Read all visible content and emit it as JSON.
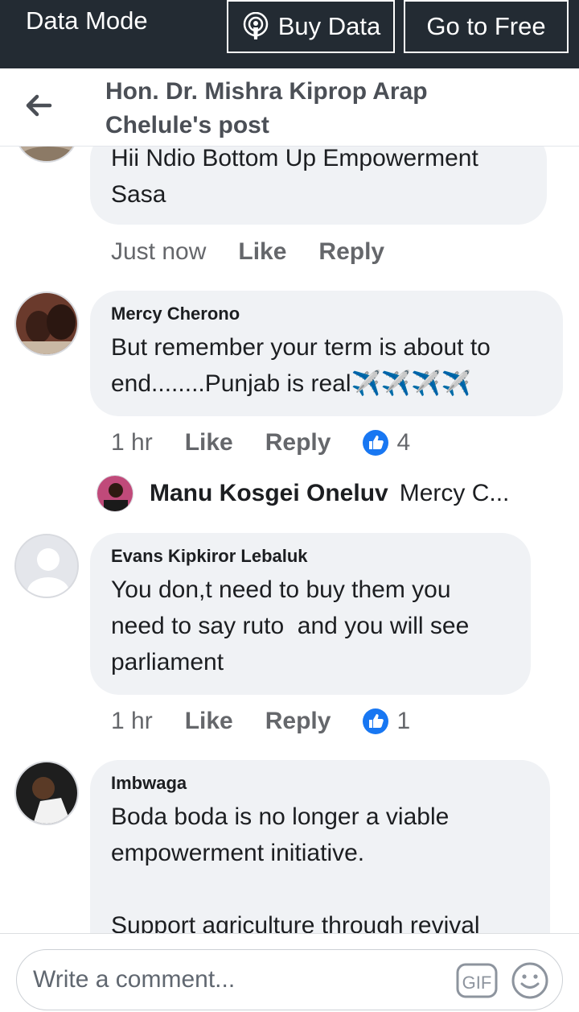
{
  "databar": {
    "mode_label": "Data Mode",
    "buy_label": "Buy Data",
    "free_label": "Go to Free"
  },
  "header": {
    "title": "Hon. Dr. Mishra Kiprop Arap Chelule's post"
  },
  "comments": [
    {
      "name": "",
      "text": "Hii Ndio Bottom Up Empowerment Sasa",
      "time": "Just now",
      "like": "Like",
      "reply": "Reply",
      "reactions": ""
    },
    {
      "name": "Mercy Cherono",
      "text": "But remember your term is about to end........Punjab is real✈️✈️✈️✈️",
      "time": "1 hr",
      "like": "Like",
      "reply": "Reply",
      "reactions": "4"
    },
    {
      "name": "Evans Kipkiror Lebaluk",
      "text": "You don,t need to buy them you need to say ruto  and you will see parliament",
      "time": "1 hr",
      "like": "Like",
      "reply": "Reply",
      "reactions": "1"
    },
    {
      "name": "Imbwaga",
      "text": "Boda boda is no longer a viable empowerment initiative.\n\nSupport agriculture through revival"
    }
  ],
  "reply_preview": {
    "name": "Manu Kosgei Oneluv",
    "text": "Mercy C..."
  },
  "composer": {
    "placeholder": "Write a comment..."
  },
  "icons": {
    "back": "arrow-left-icon",
    "buy": "podcast-icon",
    "reaction": "thumbs-up-icon",
    "gif": "gif-icon",
    "emoji": "smile-icon"
  },
  "colors": {
    "databar": "#232b33",
    "bubble": "#f0f2f5",
    "like_blue": "#1877f2"
  }
}
